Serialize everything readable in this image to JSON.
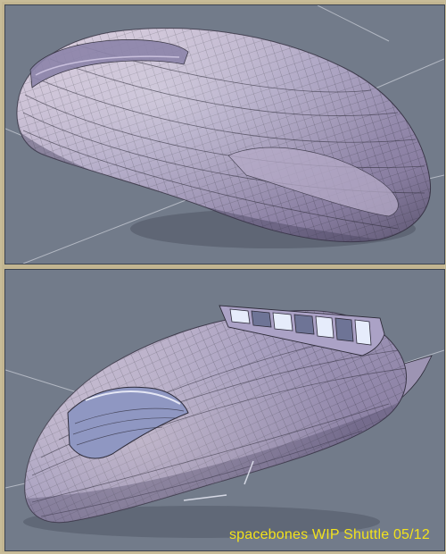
{
  "caption": "spacebones WIP Shuttle 05/12",
  "colors": {
    "viewport_bg": "#727b8a",
    "frame": "#c2b591",
    "caption": "#f2e21c",
    "hull_light": "#d7c7d6",
    "hull_mid": "#9e96b6",
    "hull_dark": "#5c5672",
    "wire": "#2e2c3a"
  },
  "views": [
    "top-view",
    "bottom-view"
  ]
}
